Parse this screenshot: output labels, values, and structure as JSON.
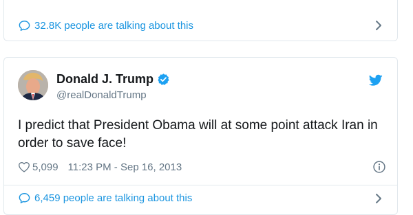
{
  "cards": [
    {
      "talking_text": "32.8K people are talking about this"
    },
    {
      "author": {
        "name": "Donald J. Trump",
        "handle": "@realDonaldTrump",
        "verified": true
      },
      "tweet_text": "I predict that President Obama will at some point attack Iran in order to save face!",
      "likes": "5,099",
      "timestamp": "11:23 PM - Sep 16, 2013",
      "talking_text": "6,459 people are talking about this"
    }
  ],
  "icons": {
    "bubble": "speech-bubble-icon",
    "chevron": "chevron-right-icon",
    "verified": "verified-badge-icon",
    "bird": "twitter-bird-icon",
    "heart": "heart-icon",
    "info": "info-icon"
  },
  "colors": {
    "link": "#1b95e0",
    "muted": "#657786",
    "text": "#14171a",
    "border": "#e1e8ed",
    "twitter_blue": "#1da1f2"
  }
}
